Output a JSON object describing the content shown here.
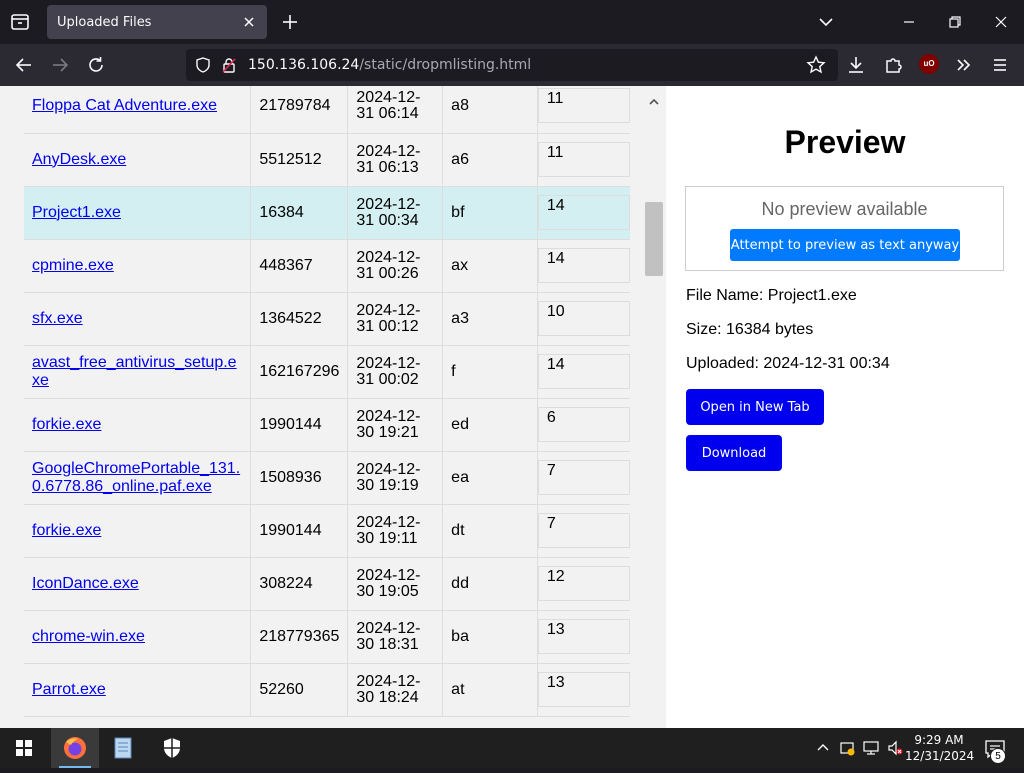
{
  "browser": {
    "tab_title": "Uploaded Files",
    "url_host": "150.136.106.24",
    "url_path": "/static/dropmlisting.html",
    "ublock_label": "uO"
  },
  "files": [
    {
      "name": "Floppa Cat Adventure.exe",
      "size": "21789784",
      "date": "2024-12-31 06:14",
      "ext": "a8",
      "count": "11"
    },
    {
      "name": "AnyDesk.exe",
      "size": "5512512",
      "date": "2024-12-31 06:13",
      "ext": "a6",
      "count": "11"
    },
    {
      "name": "Project1.exe",
      "size": "16384",
      "date": "2024-12-31 00:34",
      "ext": "bf",
      "count": "14"
    },
    {
      "name": "cpmine.exe",
      "size": "448367",
      "date": "2024-12-31 00:26",
      "ext": "ax",
      "count": "14"
    },
    {
      "name": "sfx.exe",
      "size": "1364522",
      "date": "2024-12-31 00:12",
      "ext": "a3",
      "count": "10"
    },
    {
      "name": "avast_free_antivirus_setup.exe",
      "size": "162167296",
      "date": "2024-12-31 00:02",
      "ext": "f",
      "count": "14"
    },
    {
      "name": "forkie.exe",
      "size": "1990144",
      "date": "2024-12-30 19:21",
      "ext": "ed",
      "count": "6"
    },
    {
      "name": "GoogleChromePortable_131.0.6778.86_online.paf.exe",
      "size": "1508936",
      "date": "2024-12-30 19:19",
      "ext": "ea",
      "count": "7"
    },
    {
      "name": "forkie.exe",
      "size": "1990144",
      "date": "2024-12-30 19:11",
      "ext": "dt",
      "count": "7"
    },
    {
      "name": "IconDance.exe",
      "size": "308224",
      "date": "2024-12-30 19:05",
      "ext": "dd",
      "count": "12"
    },
    {
      "name": "chrome-win.exe",
      "size": "218779365",
      "date": "2024-12-30 18:31",
      "ext": "ba",
      "count": "13"
    },
    {
      "name": "Parrot.exe",
      "size": "52260",
      "date": "2024-12-30 18:24",
      "ext": "at",
      "count": "13"
    }
  ],
  "selected_index": 2,
  "preview": {
    "title": "Preview",
    "no_preview": "No preview available",
    "attempt_label": "Attempt to preview as text anyway",
    "file_name_line": "File Name: Project1.exe",
    "size_line": "Size: 16384 bytes",
    "uploaded_line": "Uploaded: 2024-12-31 00:34",
    "open_label": "Open in New Tab",
    "download_label": "Download"
  },
  "taskbar": {
    "time": "9:29 AM",
    "date": "12/31/2024",
    "notification_count": "5"
  },
  "colors": {
    "link": "#0000ee",
    "selected_row": "#d4eff1",
    "attempt_button": "#007bff",
    "action_button": "#0000ee"
  }
}
